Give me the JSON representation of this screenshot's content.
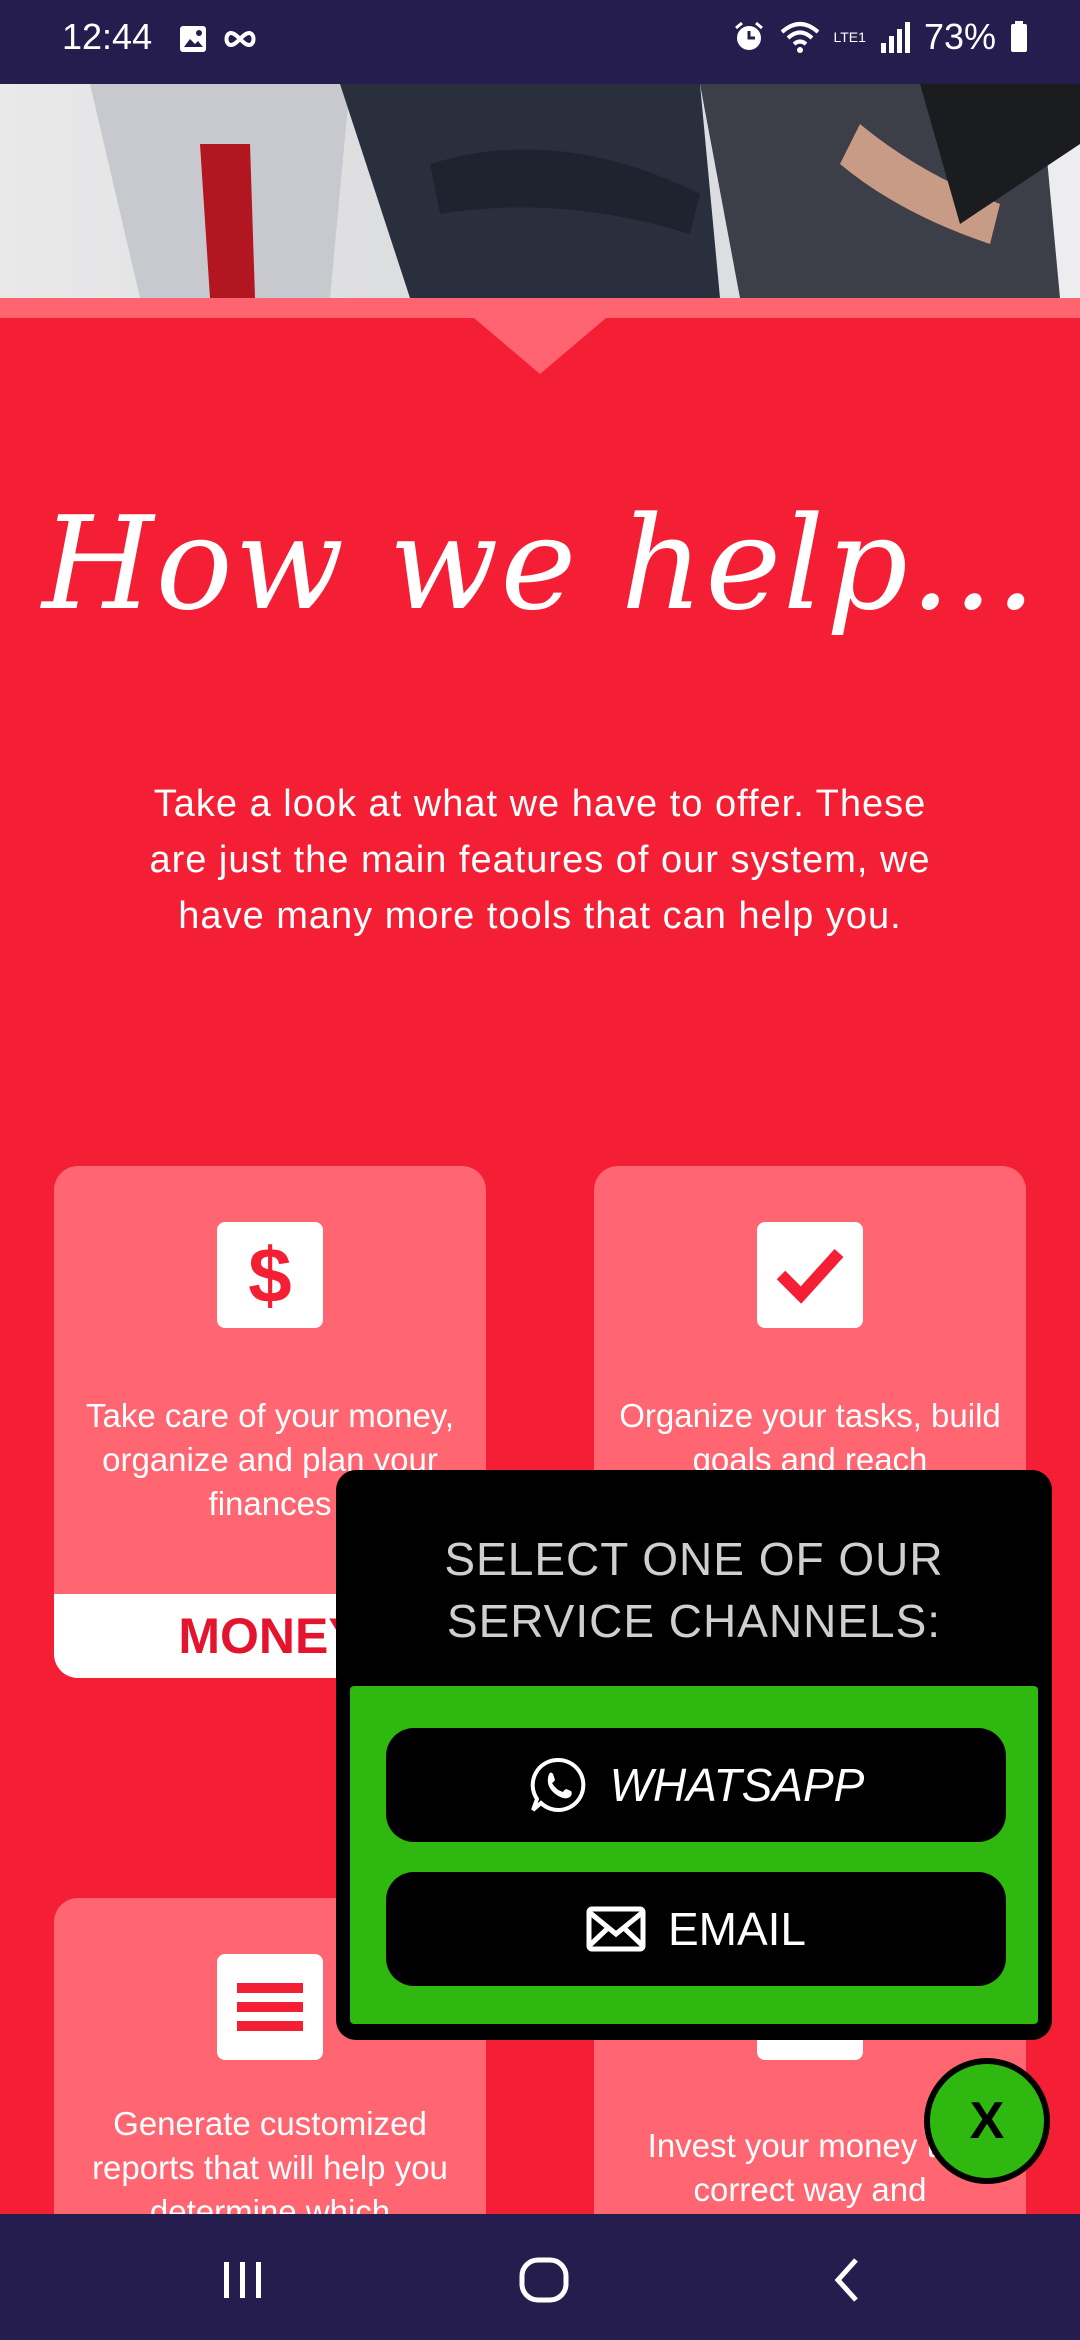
{
  "status_bar": {
    "time": "12:44",
    "battery": "73%",
    "network": "LTE1",
    "icons": [
      "image-icon",
      "infinity-icon",
      "alarm-icon",
      "wifi-icon",
      "volte-icon",
      "signal-icon",
      "battery-icon"
    ]
  },
  "hero": {
    "image": "business-people-photo"
  },
  "section": {
    "heading": "How we help...",
    "intro": "Take a look at what we have to offer. These are just the main features of our system, we have many more tools that can help you."
  },
  "cards": [
    {
      "icon": "dollar-icon",
      "text": "Take care of your money, organize and plan your finances",
      "label": "MONEY"
    },
    {
      "icon": "check-icon",
      "text": "Organize your tasks, build goals and reach",
      "label": ""
    },
    {
      "icon": "list-icon",
      "text": "Generate customized reports that will help you determine which",
      "label": ""
    },
    {
      "icon": "invest-icon",
      "text": "Invest your money the correct way and",
      "label": ""
    }
  ],
  "modal": {
    "title": "SELECT ONE OF OUR SERVICE CHANNELS:",
    "whatsapp_label": "WHATSAPP",
    "email_label": "EMAIL",
    "close_label": "X"
  },
  "colors": {
    "background": "#f41f35",
    "card": "#ff6672",
    "modal_green": "#2fb910",
    "system_bar": "#251d4d"
  }
}
